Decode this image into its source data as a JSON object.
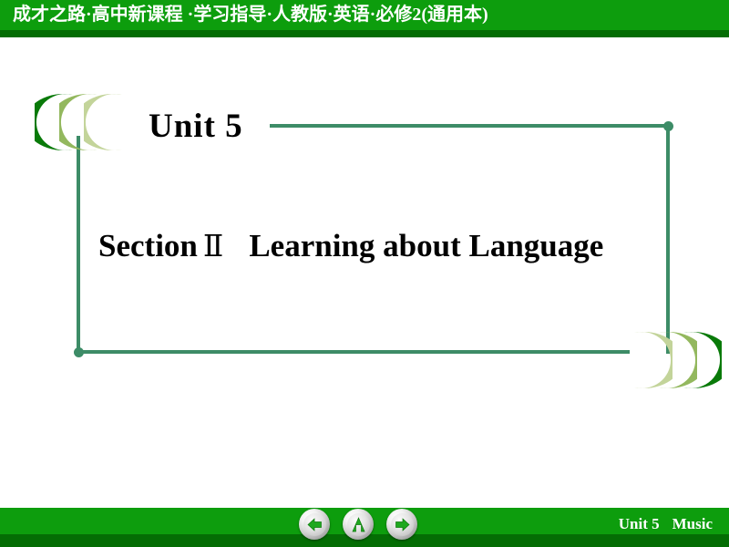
{
  "header": {
    "title": "成才之路·高中新课程 ·学习指导·人教版·英语·必修2(通用本)",
    "bg_color": "#0d9d0d",
    "shadow_color": "#046d04",
    "text_color": "#ffffff"
  },
  "slide": {
    "unit_heading": "Unit 5",
    "section_label": "Section",
    "section_numeral": "Ⅱ",
    "section_title": "Learning about Language",
    "frame_color": "#3d8c67",
    "heading_color": "#000000",
    "crescent_colors": [
      "#097a09",
      "#93b85e",
      "#c3d49a"
    ]
  },
  "footer": {
    "unit": "Unit 5",
    "topic": "Music",
    "bg_color": "#0d9d0d",
    "shadow_color": "#046d04",
    "text_color": "#ffffff",
    "nav": {
      "prev_label": "Previous slide",
      "down_label": "Next section",
      "next_label": "Next slide",
      "arrow_color": "#1fa81f"
    }
  }
}
